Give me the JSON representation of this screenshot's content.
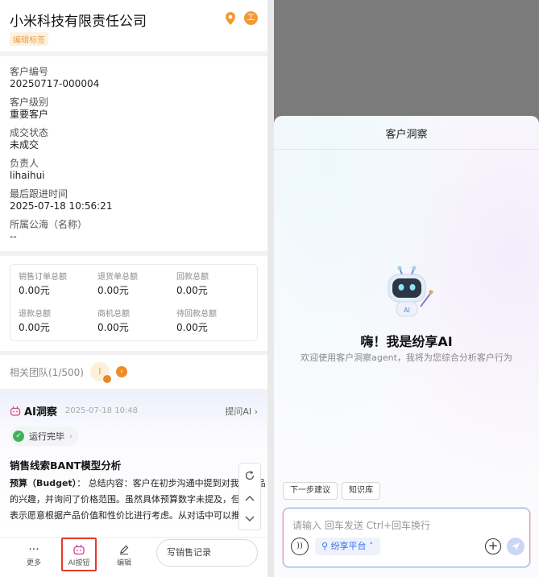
{
  "customer": {
    "name": "小米科技有限责任公司",
    "edit_tag": "编辑标签",
    "work_badge": "工"
  },
  "fields": [
    {
      "label": "客户编号",
      "value": "20250717-000004"
    },
    {
      "label": "客户级别",
      "value": "重要客户"
    },
    {
      "label": "成交状态",
      "value": "未成交"
    },
    {
      "label": "负责人",
      "value": "lihaihui"
    },
    {
      "label": "最后跟进时间",
      "value": "2025-07-18 10:56:21"
    },
    {
      "label": "所属公海（名称）",
      "value": "--"
    }
  ],
  "amounts": [
    {
      "label": "销售订单总额",
      "value": "0.00元"
    },
    {
      "label": "退货单总额",
      "value": "0.00元"
    },
    {
      "label": "回款总额",
      "value": "0.00元"
    },
    {
      "label": "退款总额",
      "value": "0.00元"
    },
    {
      "label": "商机总额",
      "value": "0.00元"
    },
    {
      "label": "待回款总额",
      "value": "0.00元"
    }
  ],
  "team": {
    "label": "相关团队(1/500)",
    "avatar_char": "l",
    "next": "›"
  },
  "ai_insight": {
    "title": "AI洞察",
    "date": "2025-07-18 10:48",
    "ask": "提问AI ›",
    "status": "运行完毕",
    "section_title": "销售线索BANT模型分析",
    "body_lead": "预算（Budget）",
    "body": "：  总结内容：客户在初步沟通中提到对我们产品的兴趣，并询问了价格范围。虽然具体预算数字未提及，但客户表示愿意根据产品价值和性价比进行考虑。从对话中可以推断，客户对投资有一定的开放态度，且正在评"
  },
  "bottom_bar": {
    "more": "更多",
    "ai_button": "AI按钮",
    "edit": "编辑",
    "write_record": "写销售记录"
  },
  "chat": {
    "title": "客户洞察",
    "greeting": "嗨！我是纷享AI",
    "subtitle": "欢迎使用客户洞察agent，我将为您综合分析客户行为",
    "robot_badge": "AI",
    "chips": [
      "下一步建议",
      "知识库"
    ],
    "input_placeholder": "请输入 回车发送 Ctrl+回车换行",
    "platform": "纷享平台 ˄"
  }
}
